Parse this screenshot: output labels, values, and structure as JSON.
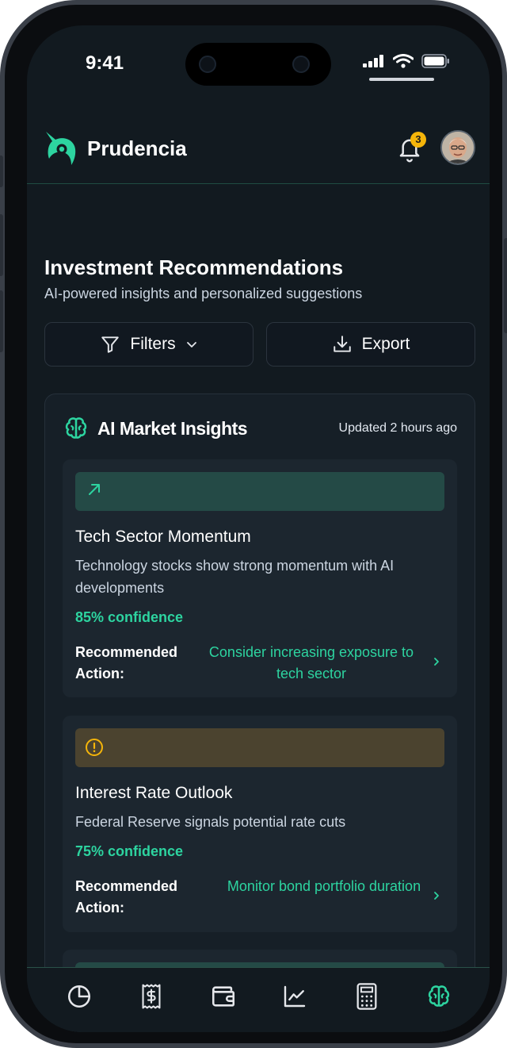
{
  "status_bar": {
    "time": "9:41"
  },
  "app": {
    "brand": "Prudencia",
    "notification_count": "3"
  },
  "page": {
    "title": "Investment Recommendations",
    "subtitle": "AI-powered insights and personalized suggestions",
    "filters_label": "Filters",
    "export_label": "Export"
  },
  "insights": {
    "title": "AI Market Insights",
    "updated": "Updated 2 hours ago",
    "items": [
      {
        "icon": "trend-up-arrow-icon",
        "band_color": "#244a46",
        "title": "Tech Sector Momentum",
        "description": "Technology stocks show strong momentum with AI developments",
        "confidence": "85% confidence",
        "action_label": "Recommended Action:",
        "action": "Consider increasing exposure to tech sector"
      },
      {
        "icon": "alert-circle-icon",
        "band_color": "#4b432f",
        "title": "Interest Rate Outlook",
        "description": "Federal Reserve signals potential rate cuts",
        "confidence": "75% confidence",
        "action_label": "Recommended Action:",
        "action": "Monitor bond portfolio duration"
      }
    ]
  },
  "bottom_nav": [
    {
      "icon": "pie-chart-icon",
      "active": false
    },
    {
      "icon": "receipt-dollar-icon",
      "active": false
    },
    {
      "icon": "wallet-icon",
      "active": false
    },
    {
      "icon": "line-chart-icon",
      "active": false
    },
    {
      "icon": "calculator-icon",
      "active": false
    },
    {
      "icon": "brain-icon",
      "active": true
    }
  ],
  "colors": {
    "accent": "#2dd4a0",
    "background": "#121a20",
    "card": "#1c262f",
    "badge": "#f5b50a"
  }
}
